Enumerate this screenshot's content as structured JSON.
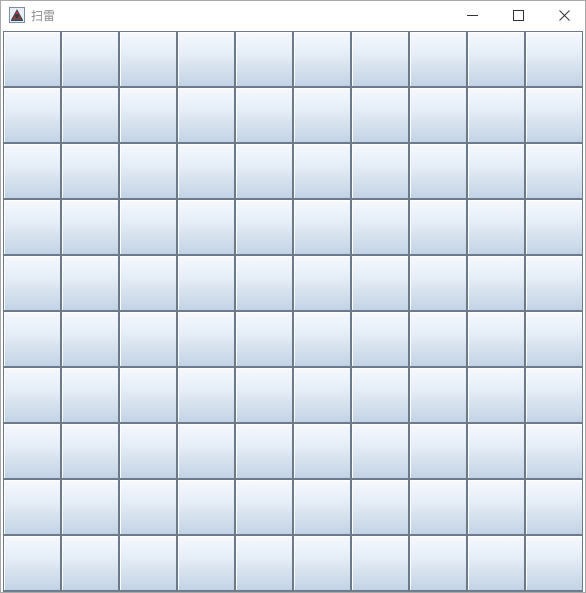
{
  "window": {
    "title": "扫雷",
    "app_icon": "java-app-icon",
    "controls": {
      "minimize_icon": "minimize-icon",
      "maximize_icon": "maximize-icon",
      "close_icon": "close-icon"
    }
  },
  "board": {
    "rows": 10,
    "cols": 10,
    "cells": [
      [
        "",
        "",
        "",
        "",
        "",
        "",
        "",
        "",
        "",
        ""
      ],
      [
        "",
        "",
        "",
        "",
        "",
        "",
        "",
        "",
        "",
        ""
      ],
      [
        "",
        "",
        "",
        "",
        "",
        "",
        "",
        "",
        "",
        ""
      ],
      [
        "",
        "",
        "",
        "",
        "",
        "",
        "",
        "",
        "",
        ""
      ],
      [
        "",
        "",
        "",
        "",
        "",
        "",
        "",
        "",
        "",
        ""
      ],
      [
        "",
        "",
        "",
        "",
        "",
        "",
        "",
        "",
        "",
        ""
      ],
      [
        "",
        "",
        "",
        "",
        "",
        "",
        "",
        "",
        "",
        ""
      ],
      [
        "",
        "",
        "",
        "",
        "",
        "",
        "",
        "",
        "",
        ""
      ],
      [
        "",
        "",
        "",
        "",
        "",
        "",
        "",
        "",
        "",
        ""
      ],
      [
        "",
        "",
        "",
        "",
        "",
        "",
        "",
        "",
        "",
        ""
      ]
    ]
  }
}
